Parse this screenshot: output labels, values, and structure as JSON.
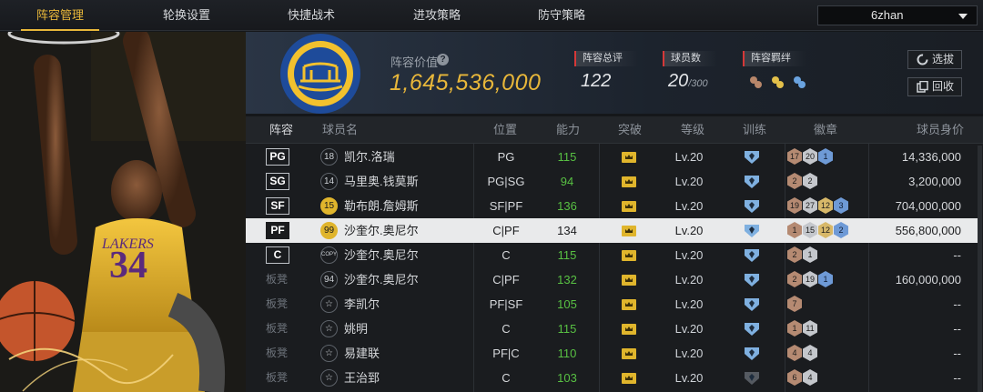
{
  "nav": {
    "tabs": [
      "阵容管理",
      "轮换设置",
      "快捷战术",
      "进攻策略",
      "防守策略"
    ],
    "active_tab": 0,
    "team_select": "6zhan"
  },
  "summary": {
    "value_label": "阵容价值",
    "value": "1,645,536,000",
    "rating_label": "阵容总评",
    "rating": "122",
    "players_label": "球员数",
    "players": "20",
    "players_max": "/300",
    "bond_label": "阵容羁绊",
    "buttons": {
      "scout": "选拔",
      "recycle": "回收"
    }
  },
  "table": {
    "headers": [
      "阵容",
      "球员名",
      "位置",
      "能力",
      "突破",
      "等级",
      "训练",
      "徽章",
      "球员身价"
    ],
    "rows": [
      {
        "slot": "PG",
        "num": "18",
        "name": "凯尔.洛瑞",
        "pos": "PG",
        "ability": "115",
        "ability_color": "#58c043",
        "level": "Lv.20",
        "badges": [
          [
            "bronze",
            "17"
          ],
          [
            "silver",
            "20"
          ],
          [
            "blue",
            "1"
          ]
        ],
        "value": "14,336,000"
      },
      {
        "slot": "SG",
        "num": "14",
        "name": "马里奥.钱莫斯",
        "pos": "PG|SG",
        "ability": "94",
        "ability_color": "#58c043",
        "level": "Lv.20",
        "badges": [
          [
            "bronze",
            "2"
          ],
          [
            "silver",
            "2"
          ]
        ],
        "value": "3,200,000"
      },
      {
        "slot": "SF",
        "num": "15",
        "name": "勒布朗.詹姆斯",
        "pos": "SF|PF",
        "ability": "136",
        "ability_color": "#58c043",
        "level": "Lv.20",
        "badges": [
          [
            "bronze",
            "19"
          ],
          [
            "silver",
            "27"
          ],
          [
            "gold",
            "12"
          ],
          [
            "blue",
            "3"
          ]
        ],
        "value": "704,000,000"
      },
      {
        "slot": "PF",
        "num": "99",
        "name": "沙奎尔.奥尼尔",
        "pos": "C|PF",
        "ability": "134",
        "ability_color": "#1b1c1e",
        "level": "Lv.20",
        "badges": [
          [
            "bronze",
            "1"
          ],
          [
            "silver",
            "15"
          ],
          [
            "gold",
            "12"
          ],
          [
            "blue",
            "2"
          ]
        ],
        "value": "556,800,000"
      },
      {
        "slot": "C",
        "num": "COPY",
        "name": "沙奎尔.奥尼尔",
        "pos": "C",
        "ability": "115",
        "ability_color": "#58c043",
        "level": "Lv.20",
        "badges": [
          [
            "bronze",
            "2"
          ],
          [
            "silver",
            "1"
          ]
        ],
        "value": "--"
      },
      {
        "slot": "板凳",
        "num": "94",
        "name": "沙奎尔.奥尼尔",
        "pos": "C|PF",
        "ability": "132",
        "ability_color": "#58c043",
        "level": "Lv.20",
        "badges": [
          [
            "bronze",
            "2"
          ],
          [
            "silver",
            "19"
          ],
          [
            "blue",
            "1"
          ]
        ],
        "value": "160,000,000"
      },
      {
        "slot": "板凳",
        "num": "☆",
        "name": "李凯尔",
        "pos": "PF|SF",
        "ability": "105",
        "ability_color": "#58c043",
        "level": "Lv.20",
        "badges": [
          [
            "bronze",
            "7"
          ]
        ],
        "value": "--"
      },
      {
        "slot": "板凳",
        "num": "☆",
        "name": "姚明",
        "pos": "C",
        "ability": "115",
        "ability_color": "#58c043",
        "level": "Lv.20",
        "badges": [
          [
            "bronze",
            "1"
          ],
          [
            "silver",
            "11"
          ]
        ],
        "value": "--"
      },
      {
        "slot": "板凳",
        "num": "☆",
        "name": "易建联",
        "pos": "PF|C",
        "ability": "110",
        "ability_color": "#58c043",
        "level": "Lv.20",
        "badges": [
          [
            "bronze",
            "4"
          ],
          [
            "silver",
            "4"
          ]
        ],
        "value": "--"
      },
      {
        "slot": "板凳",
        "num": "☆",
        "name": "王治郅",
        "pos": "C",
        "ability": "103",
        "ability_color": "#58c043",
        "level": "Lv.20",
        "badges": [
          [
            "bronze",
            "6"
          ],
          [
            "silver",
            "4"
          ]
        ],
        "value": "--"
      }
    ]
  },
  "colors": {
    "accent": "#e8b73a",
    "ability_green": "#58c043",
    "tag_red": "#d63838"
  }
}
